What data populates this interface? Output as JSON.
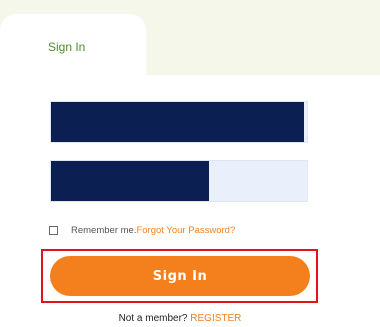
{
  "tabs": {
    "active_label": "Sign In"
  },
  "form": {
    "username_value": "",
    "password_value": "",
    "remember_label": "Remember me.",
    "forgot_password_label": "Forgot Your Password?",
    "submit_label": "Sign In"
  },
  "footer": {
    "not_member_label": "Not a member?",
    "register_label": "REGISTER"
  },
  "colors": {
    "accent_orange": "#f47f1d",
    "tab_green_text": "#4e8c2e",
    "tab_bar_background": "#f4f7ea",
    "redacted_fill": "#0c1f52",
    "input_background": "#e9f0fb",
    "highlight_red": "#e0131a"
  }
}
